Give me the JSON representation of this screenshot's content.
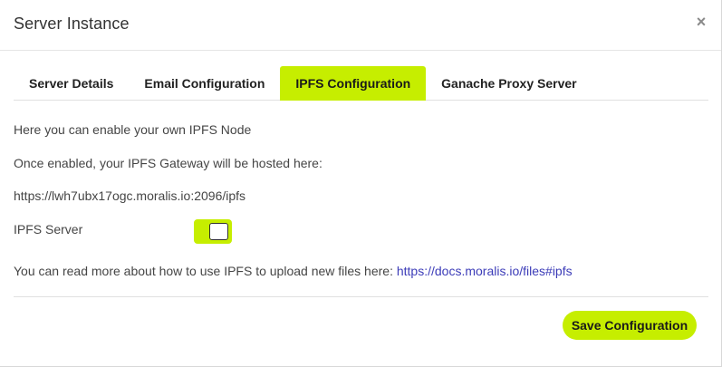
{
  "modal": {
    "title": "Server Instance",
    "close_symbol": "×"
  },
  "tabs": [
    {
      "label": "Server Details",
      "active": false
    },
    {
      "label": "Email Configuration",
      "active": false
    },
    {
      "label": "IPFS Configuration",
      "active": true
    },
    {
      "label": "Ganache Proxy Server",
      "active": false
    }
  ],
  "ipfs": {
    "intro": "Here you can enable your own IPFS Node",
    "gateway_note": "Once enabled, your IPFS Gateway will be hosted here:",
    "gateway_url": "https://lwh7ubx17ogc.moralis.io:2096/ipfs",
    "server_label": "IPFS Server",
    "server_enabled": true,
    "read_more_text": "You can read more about how to use IPFS to upload new files here: ",
    "docs_link": "https://docs.moralis.io/files#ipfs"
  },
  "footer": {
    "save_label": "Save Configuration"
  },
  "colors": {
    "accent": "#c6ee00",
    "link": "#3c3cb8"
  },
  "icons": {
    "close": "close-icon"
  }
}
